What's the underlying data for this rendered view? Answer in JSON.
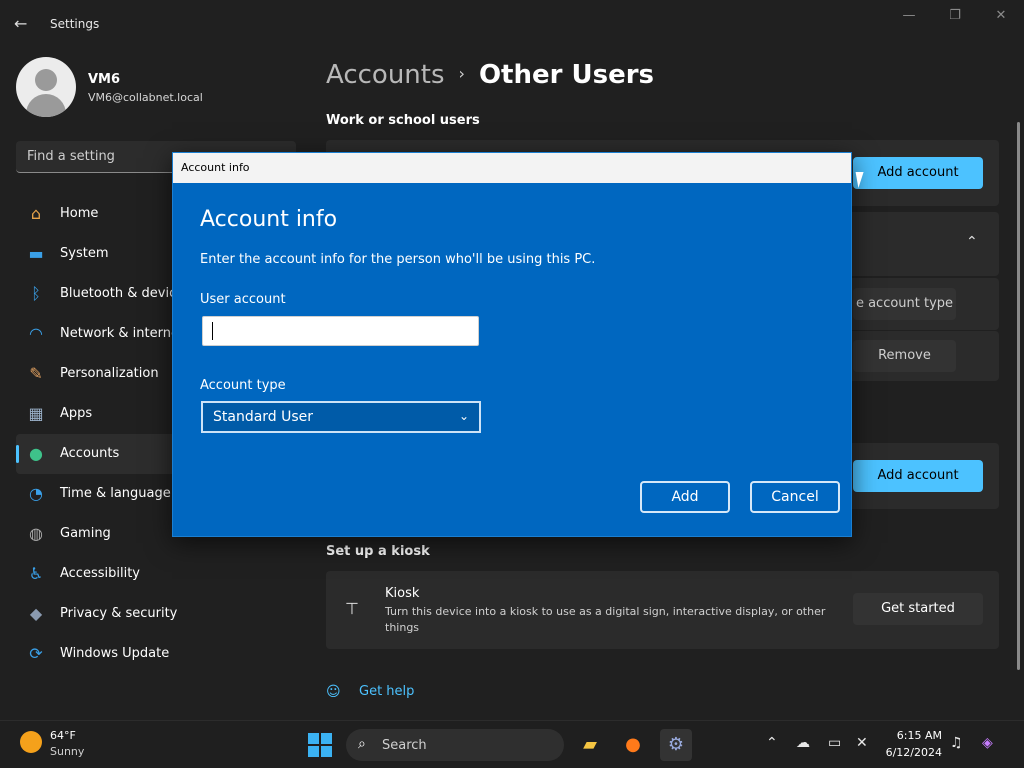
{
  "window": {
    "title": "Settings",
    "minimize": "—",
    "maximize": "❐",
    "close": "✕"
  },
  "profile": {
    "name": "VM6",
    "email": "VM6@collabnet.local"
  },
  "search": {
    "placeholder": "Find a setting"
  },
  "nav": [
    {
      "label": "Home",
      "icon": "home-icon",
      "active": false
    },
    {
      "label": "System",
      "icon": "system-icon",
      "active": false
    },
    {
      "label": "Bluetooth & devic",
      "icon": "bluetooth-icon",
      "active": false
    },
    {
      "label": "Network & interne",
      "icon": "wifi-icon",
      "active": false
    },
    {
      "label": "Personalization",
      "icon": "brush-icon",
      "active": false
    },
    {
      "label": "Apps",
      "icon": "apps-icon",
      "active": false
    },
    {
      "label": "Accounts",
      "icon": "person-icon",
      "active": true
    },
    {
      "label": "Time & language",
      "icon": "clock-globe-icon",
      "active": false
    },
    {
      "label": "Gaming",
      "icon": "gamepad-icon",
      "active": false
    },
    {
      "label": "Accessibility",
      "icon": "accessibility-icon",
      "active": false
    },
    {
      "label": "Privacy & security",
      "icon": "shield-icon",
      "active": false
    },
    {
      "label": "Windows Update",
      "icon": "update-icon",
      "active": false
    }
  ],
  "breadcrumb": {
    "parent": "Accounts",
    "separator": "›",
    "current": "Other Users"
  },
  "sections": {
    "work": "Work or school users",
    "kiosk": "Set up a kiosk"
  },
  "work_card": {
    "add_label": "Add account"
  },
  "other_card": {
    "change_type_label": "e account type",
    "remove_label": "Remove",
    "add_label": "Add account",
    "chevron": "⌃"
  },
  "kiosk": {
    "title": "Kiosk",
    "description": "Turn this device into a kiosk to use as a digital sign, interactive display, or other things",
    "button": "Get started"
  },
  "help": {
    "label": "Get help"
  },
  "dialog": {
    "titlebar": "Account info",
    "heading": "Account info",
    "subtitle": "Enter the account info for the person who'll be using this PC.",
    "user_label": "User account",
    "user_value": "",
    "type_label": "Account type",
    "type_value": "Standard User",
    "add": "Add",
    "cancel": "Cancel"
  },
  "taskbar": {
    "temp": "64°F",
    "condition": "Sunny",
    "search": "Search",
    "time": "6:15 AM",
    "date": "6/12/2024"
  },
  "colors": {
    "accent": "#4cc2ff",
    "dialog": "#0067c0"
  }
}
